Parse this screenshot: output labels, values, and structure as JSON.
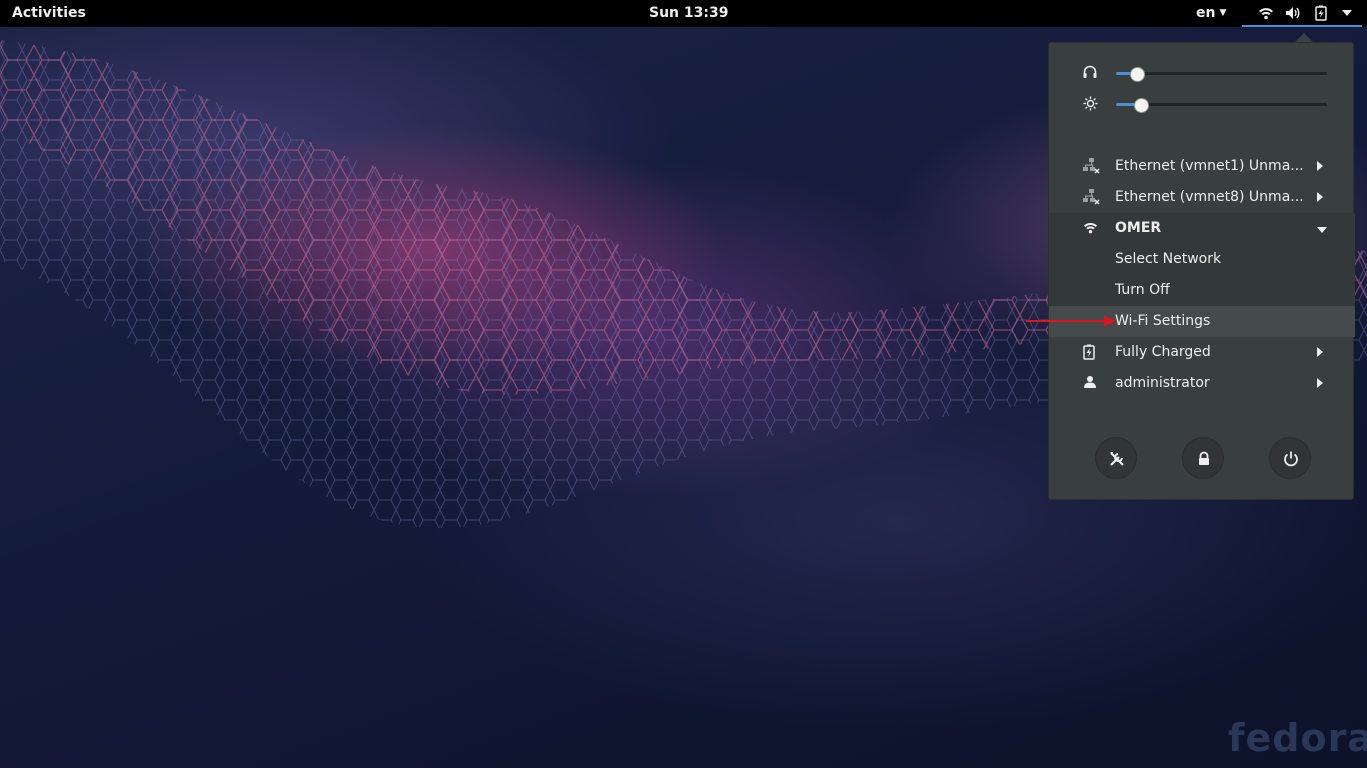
{
  "topbar": {
    "activities": "Activities",
    "clock": "Sun 13:39",
    "language": "en",
    "icons": [
      "wifi-icon",
      "volume-icon",
      "battery-charged-icon",
      "chevron-down-icon"
    ]
  },
  "menu": {
    "sliders": [
      {
        "icon": "headphones-icon",
        "level": 0.1
      },
      {
        "icon": "brightness-icon",
        "level": 0.12
      }
    ],
    "items": {
      "eth1": "Ethernet (vmnet1) Unma...",
      "eth8": "Ethernet (vmnet8) Unma...",
      "wifi": "OMER",
      "select_network": "Select Network",
      "turn_off": "Turn Off",
      "wifi_settings": "Wi-Fi Settings",
      "battery": "Fully Charged",
      "user": "administrator"
    },
    "buttons": [
      "settings-icon",
      "lock-icon",
      "power-icon"
    ]
  },
  "wallpaper": {
    "brand": "fedora"
  },
  "colors": {
    "accent": "#4a90d9",
    "menu_bg": "#393f3f",
    "annotation": "#e0141e"
  }
}
